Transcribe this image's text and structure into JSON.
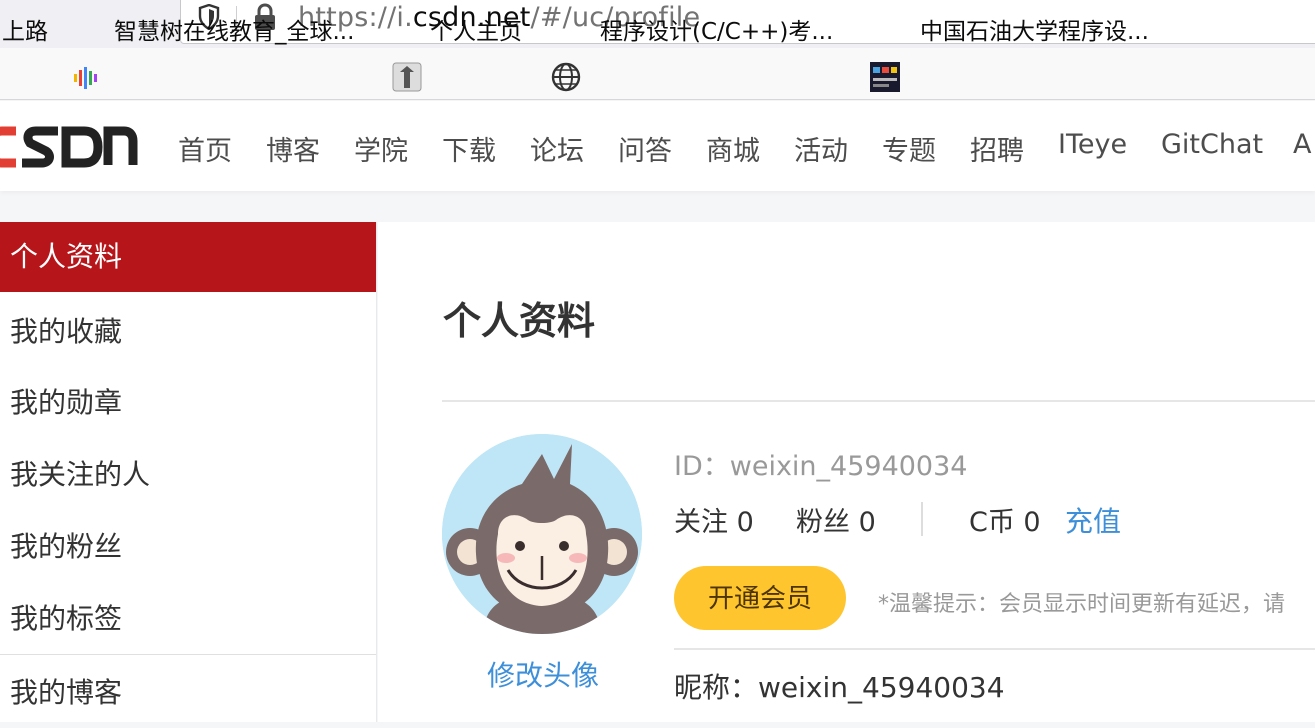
{
  "browser": {
    "url_prefix": "https://i.",
    "url_domain": "csdn.net",
    "url_path": "/#/uc/profile",
    "bookmarks": [
      {
        "label": "上路",
        "icon": "none"
      },
      {
        "label": "智慧树在线教育_全球...",
        "icon": "audio-bars-icon"
      },
      {
        "label": "个人主页",
        "icon": "avatar-icon"
      },
      {
        "label": "程序设计(C/C++)考...",
        "icon": "globe-icon"
      },
      {
        "label": "中国石油大学程序设...",
        "icon": "site-icon"
      }
    ]
  },
  "nav": {
    "items": [
      "首页",
      "博客",
      "学院",
      "下载",
      "论坛",
      "问答",
      "商城",
      "活动",
      "专题",
      "招聘",
      "ITeye",
      "GitChat",
      "A"
    ]
  },
  "sidebar": {
    "items": [
      "个人资料",
      "我的收藏",
      "我的勋章",
      "我关注的人",
      "我的粉丝",
      "我的标签",
      "我的博客"
    ],
    "active_index": 0
  },
  "profile": {
    "title": "个人资料",
    "change_avatar": "修改头像",
    "id_line": "ID：weixin_45940034",
    "following_label": "关注 0",
    "fans_label": "粉丝 0",
    "coins_label": "C币 0",
    "recharge": "充值",
    "vip_button": "开通会员",
    "hint": "*温馨提示：会员显示时间更新有延迟，请",
    "nickname": "昵称：weixin_45940034"
  },
  "colors": {
    "brand_red": "#b6151a",
    "link_blue": "#3d8fd9",
    "vip_yellow": "#fec52f"
  }
}
